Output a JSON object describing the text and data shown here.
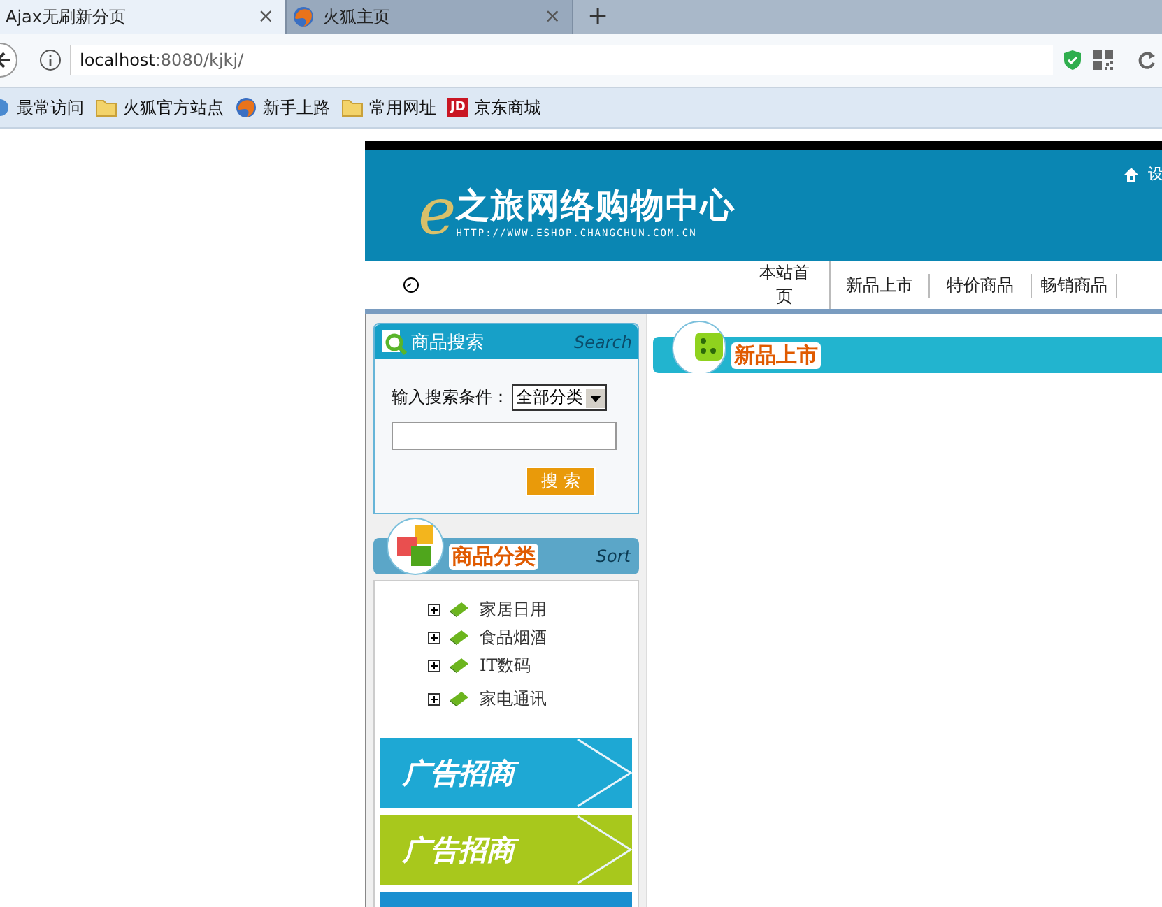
{
  "browser": {
    "tabs": [
      {
        "title": "Ajax无刷新分页",
        "selected": true,
        "kind": "plain"
      },
      {
        "title": "火狐主页",
        "selected": false,
        "kind": "fox"
      }
    ],
    "close_glyph": "×",
    "new_tab": "+",
    "url": {
      "host": "localhost",
      "rest": ":8080/kjkj/"
    },
    "bookmarks": [
      {
        "label": "最常访问",
        "kind": "star"
      },
      {
        "label": "火狐官方站点",
        "kind": "folder"
      },
      {
        "label": "新手上路",
        "kind": "fox"
      },
      {
        "label": "常用网址",
        "kind": "folder"
      },
      {
        "label": "京东商城",
        "kind": "jd",
        "badge": "JD"
      }
    ]
  },
  "site": {
    "header": {
      "logo_mark": "e",
      "logo_title": "之旅网络购物中心",
      "logo_url": "HTTP://WWW.ESHOP.CHANGCHUN.COM.CN",
      "top_link": "设"
    },
    "nav": {
      "items": [
        "本站首页",
        "新品上市",
        "特价商品",
        "畅销商品"
      ]
    },
    "search": {
      "title": "商品搜索",
      "title_en": "Search",
      "label": "输入搜索条件：",
      "category": "全部分类",
      "button": "搜 索"
    },
    "categories": {
      "title": "商品分类",
      "title_en": "Sort",
      "items": [
        "家居日用",
        "食品烟酒",
        "IT数码",
        "家电通讯"
      ]
    },
    "ads": [
      {
        "text": "广告招商",
        "color": "#1ea8d4"
      },
      {
        "text": "广告招商",
        "color": "#a8c81c"
      },
      {
        "color": "#1a8fd0"
      }
    ],
    "main": {
      "title": "新品上市"
    }
  }
}
